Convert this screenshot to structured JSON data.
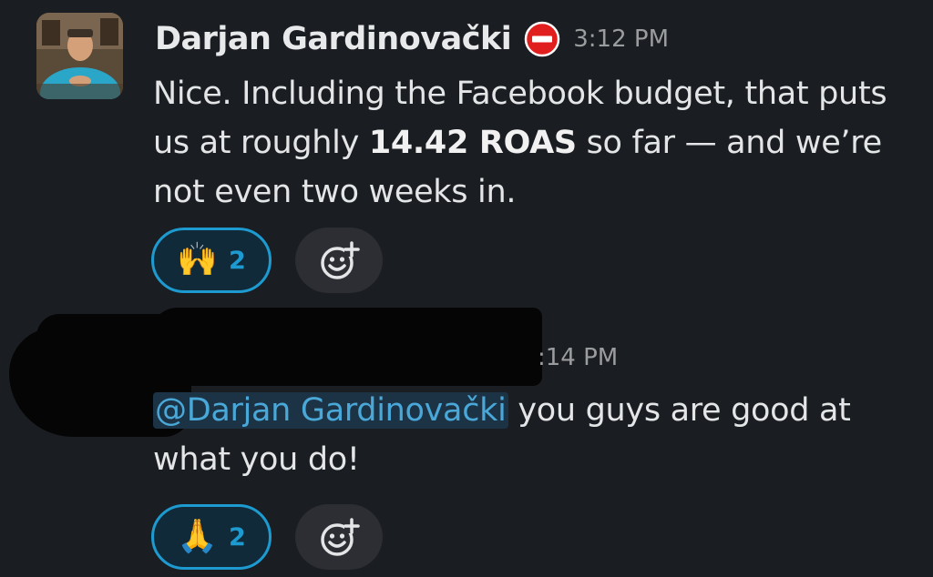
{
  "message1": {
    "author": "Darjan Gardinovački",
    "status_icon": "no-entry-icon",
    "timestamp": "3:12 PM",
    "text_part1": "Nice. Including the Facebook budget, that puts us at roughly ",
    "text_bold": "14.42 ROAS",
    "text_part2": " so far — and we’re not even two weeks in.",
    "reaction": {
      "emoji": "🙌",
      "icon": "raised-hands-icon",
      "count": "2"
    },
    "add_reaction_icon": "add-reaction-icon"
  },
  "message2": {
    "timestamp": ":14 PM",
    "mention": "@Darjan Gardinovački",
    "text": " you guys are good at what you do!",
    "reaction": {
      "emoji": "🙏",
      "icon": "folded-hands-icon",
      "count": "2"
    },
    "add_reaction_icon": "add-reaction-icon"
  },
  "colors": {
    "background": "#1a1d21",
    "accent": "#1d9bd1",
    "mention_bg": "#1c3346",
    "status_red": "#e01e1e"
  }
}
